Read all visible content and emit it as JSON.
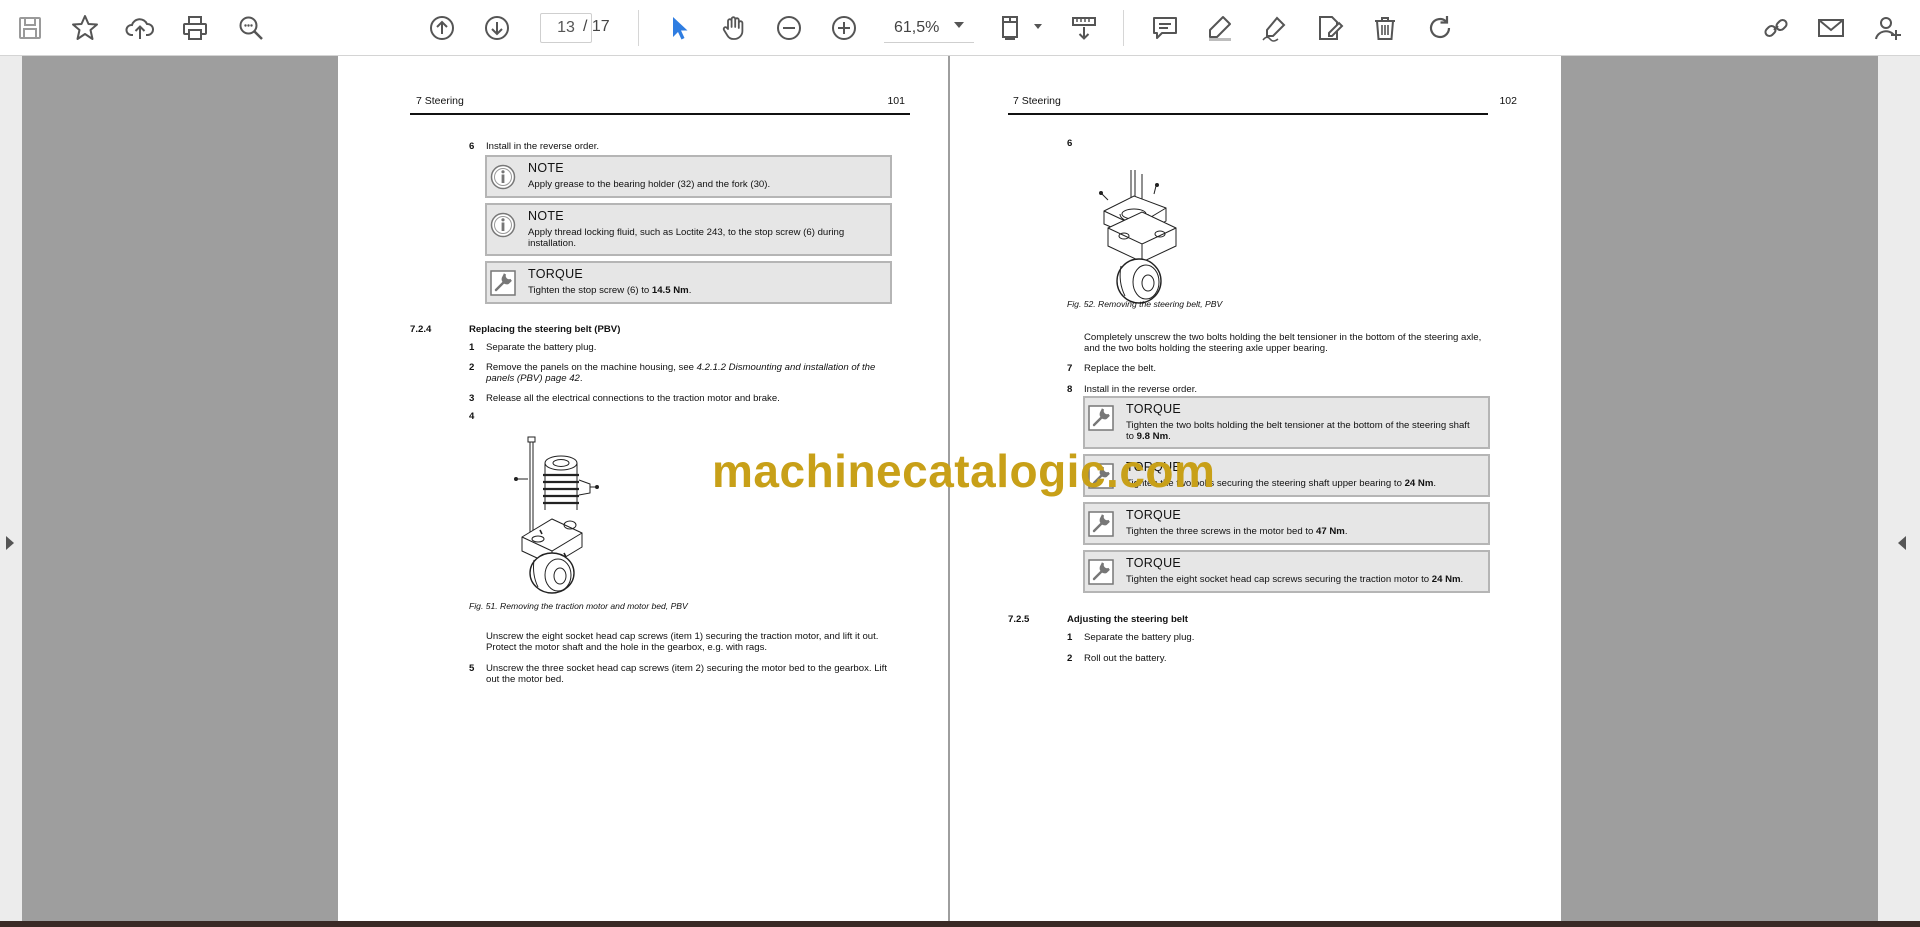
{
  "toolbar": {
    "current_page": "13",
    "page_total": "/ 17",
    "zoom": "61,5%"
  },
  "left_page": {
    "header_title": "7 Steering",
    "header_page": "101",
    "step6_num": "6",
    "step6_text": "Install in the reverse order.",
    "note1": {
      "title": "NOTE",
      "text": "Apply grease to the bearing holder (32) and the fork (30)."
    },
    "note2": {
      "title": "NOTE",
      "text": "Apply thread locking fluid, such as Loctite 243, to the stop screw (6) during installation."
    },
    "torque1": {
      "title": "TORQUE",
      "text": "Tighten the stop screw (6) to ",
      "value": "14.5 Nm",
      "suffix": "."
    },
    "section_num": "7.2.4",
    "section_title": "Replacing the steering belt (PBV)",
    "steps": [
      {
        "num": "1",
        "text": "Separate the battery plug."
      },
      {
        "num": "2",
        "text": "Remove the panels on the machine housing, see ",
        "ref": "4.2.1.2 Dismounting and installation of the panels (PBV) page 42",
        "suffix": "."
      },
      {
        "num": "3",
        "text": "Release all the electrical connections to the traction motor and brake."
      },
      {
        "num": "4",
        "text": ""
      }
    ],
    "fig_caption": "Fig. 51. Removing the traction motor and motor bed, PBV",
    "after_fig_text": "Unscrew the eight socket head cap screws (item 1) securing the traction motor, and lift it out. Protect the motor shaft and the hole in the gearbox, e.g. with rags.",
    "step5_num": "5",
    "step5_text": "Unscrew the three socket head cap screws (item 2) securing the motor bed to the gearbox. Lift out the motor bed."
  },
  "right_page": {
    "header_title": "7 Steering",
    "header_page": "102",
    "step6_num": "6",
    "fig_caption": "Fig. 52. Removing the steering belt, PBV",
    "after_fig_text": "Completely unscrew the two bolts holding the belt tensioner in the bottom of the steering axle, and the two bolts holding the steering axle upper bearing.",
    "step7_num": "7",
    "step7_text": "Replace the belt.",
    "step8_num": "8",
    "step8_text": "Install in the reverse order.",
    "torques": [
      {
        "title": "TORQUE",
        "text": "Tighten the two bolts holding the belt tensioner at the bottom of the steering shaft to ",
        "value": "9.8 Nm",
        "suffix": "."
      },
      {
        "title": "TORQUE",
        "text": "Tighten the two bolts securing the steering shaft upper bearing to ",
        "value": "24 Nm",
        "suffix": "."
      },
      {
        "title": "TORQUE",
        "text": "Tighten the three screws in the motor bed to ",
        "value": "47 Nm",
        "suffix": "."
      },
      {
        "title": "TORQUE",
        "text": "Tighten the eight socket head cap screws securing the traction motor to ",
        "value": "24 Nm",
        "suffix": "."
      }
    ],
    "section_num": "7.2.5",
    "section_title": "Adjusting the steering belt",
    "steps": [
      {
        "num": "1",
        "text": "Separate the battery plug."
      },
      {
        "num": "2",
        "text": "Roll out the battery."
      }
    ]
  },
  "watermark": "machinecatalogic.com"
}
